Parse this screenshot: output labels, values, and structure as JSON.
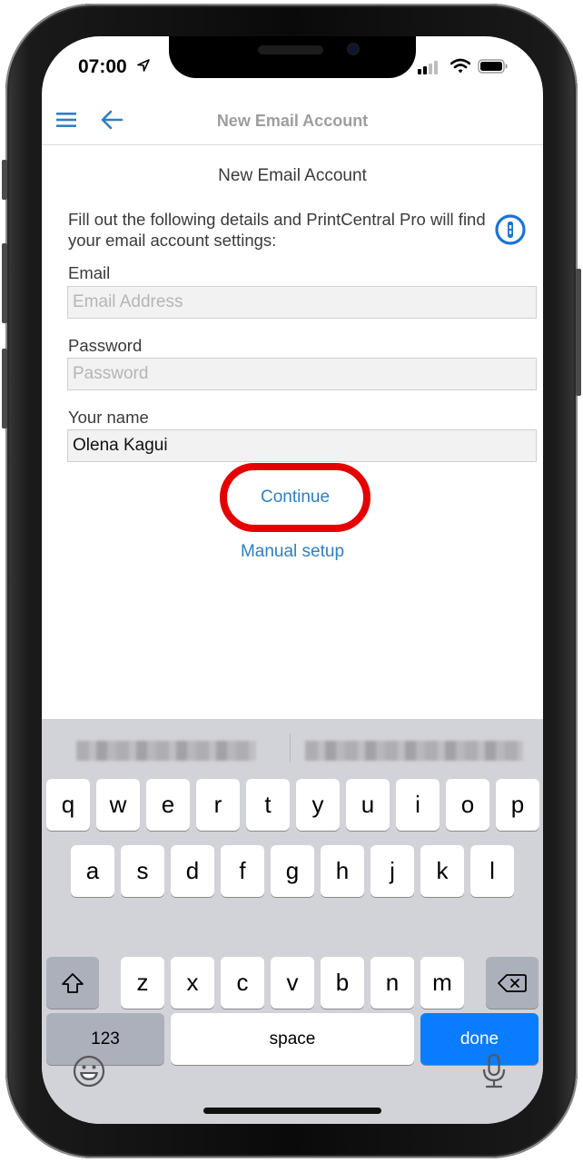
{
  "status_bar": {
    "time": "07:00",
    "icons": [
      "location-arrow-icon",
      "cellular-signal-icon",
      "wifi-icon",
      "battery-icon"
    ]
  },
  "nav_bar": {
    "title": "New Email Account",
    "left_icons": [
      "menu-icon",
      "back-arrow-icon"
    ]
  },
  "form": {
    "title": "New Email Account",
    "description": "Fill out the following details and PrintCentral Pro will find your email account settings:",
    "password_manager_icon": "1password-icon",
    "fields": [
      {
        "label": "Email",
        "placeholder": "Email Address",
        "value": ""
      },
      {
        "label": "Password",
        "placeholder": "Password",
        "value": ""
      },
      {
        "label": "Your name",
        "placeholder": "",
        "value": "Olena Kagui"
      }
    ],
    "continue_label": "Continue",
    "manual_setup_label": "Manual setup",
    "highlight_color": "#e60000",
    "link_color": "#2f7fc4"
  },
  "keyboard": {
    "suggestions": [
      "(blurred email suggestion)",
      "(blurred email suggestion)"
    ],
    "rows": [
      [
        "q",
        "w",
        "e",
        "r",
        "t",
        "y",
        "u",
        "i",
        "o",
        "p"
      ],
      [
        "a",
        "s",
        "d",
        "f",
        "g",
        "h",
        "j",
        "k",
        "l"
      ],
      [
        "z",
        "x",
        "c",
        "v",
        "b",
        "n",
        "m"
      ]
    ],
    "numbers_label": "123",
    "space_label": "space",
    "done_label": "done",
    "accent_color": "#0a7cff",
    "icons": [
      "shift-icon",
      "delete-icon",
      "emoji-icon",
      "microphone-icon"
    ]
  }
}
